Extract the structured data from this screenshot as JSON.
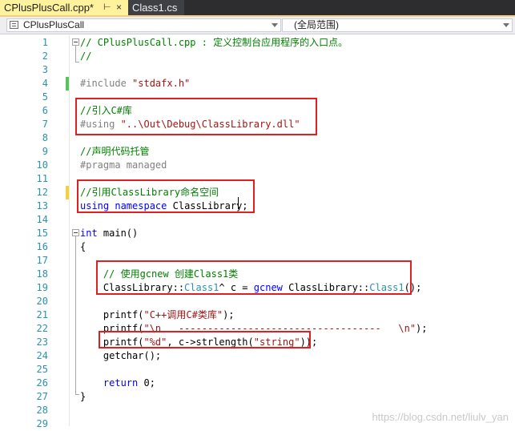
{
  "tabs": {
    "active": {
      "label": "CPlusPlusCall.cpp*",
      "pin": "⊢",
      "close": "×"
    },
    "inactive": {
      "label": "Class1.cs"
    }
  },
  "nav": {
    "project_scope": "CPlusPlusCall",
    "member_scope": "(全局范围)"
  },
  "lines": [
    {
      "n": "1",
      "parts": [
        {
          "t": "// CPlusPlusCall.cpp : 定义控制台应用程序的入口点。",
          "c": "cm"
        }
      ]
    },
    {
      "n": "2",
      "parts": [
        {
          "t": "//",
          "c": "cm"
        }
      ]
    },
    {
      "n": "3",
      "parts": []
    },
    {
      "n": "4",
      "parts": [
        {
          "t": "#include ",
          "c": "pp"
        },
        {
          "t": "\"stdafx.h\"",
          "c": "st"
        }
      ]
    },
    {
      "n": "5",
      "parts": []
    },
    {
      "n": "6",
      "parts": [
        {
          "t": "//引入C#库",
          "c": "cm"
        }
      ]
    },
    {
      "n": "7",
      "parts": [
        {
          "t": "#using ",
          "c": "pp"
        },
        {
          "t": "\"..\\Out\\Debug\\ClassLibrary.dll\"",
          "c": "st"
        }
      ]
    },
    {
      "n": "8",
      "parts": []
    },
    {
      "n": "9",
      "parts": [
        {
          "t": "//声明代码托管",
          "c": "cm"
        }
      ]
    },
    {
      "n": "10",
      "parts": [
        {
          "t": "#pragma managed",
          "c": "pp"
        }
      ]
    },
    {
      "n": "11",
      "parts": []
    },
    {
      "n": "12",
      "parts": [
        {
          "t": "//引用ClassLibrary命名空间",
          "c": "cm"
        }
      ]
    },
    {
      "n": "13",
      "parts": [
        {
          "t": "using",
          "c": "kw"
        },
        {
          "t": " ",
          "c": ""
        },
        {
          "t": "namespace",
          "c": "kw"
        },
        {
          "t": " ClassLibrary;",
          "c": ""
        }
      ]
    },
    {
      "n": "14",
      "parts": []
    },
    {
      "n": "15",
      "parts": [
        {
          "t": "int",
          "c": "kw"
        },
        {
          "t": " main()",
          "c": ""
        }
      ]
    },
    {
      "n": "16",
      "parts": [
        {
          "t": "{",
          "c": ""
        }
      ]
    },
    {
      "n": "17",
      "parts": []
    },
    {
      "n": "18",
      "parts": [
        {
          "t": "    // 使用gcnew 创建Class1类",
          "c": "cm"
        }
      ]
    },
    {
      "n": "19",
      "parts": [
        {
          "t": "    ClassLibrary::",
          "c": ""
        },
        {
          "t": "Class1",
          "c": "ty"
        },
        {
          "t": "^ c = ",
          "c": ""
        },
        {
          "t": "gcnew",
          "c": "kw"
        },
        {
          "t": " ClassLibrary::",
          "c": ""
        },
        {
          "t": "Class1",
          "c": "ty"
        },
        {
          "t": "();",
          "c": ""
        }
      ]
    },
    {
      "n": "20",
      "parts": []
    },
    {
      "n": "21",
      "parts": [
        {
          "t": "    printf(",
          "c": ""
        },
        {
          "t": "\"C++调用C#类库\"",
          "c": "st"
        },
        {
          "t": ");",
          "c": ""
        }
      ]
    },
    {
      "n": "22",
      "parts": [
        {
          "t": "    printf(",
          "c": ""
        },
        {
          "t": "\"\\n   -----------------------------------   \\n\"",
          "c": "st"
        },
        {
          "t": ");",
          "c": ""
        }
      ]
    },
    {
      "n": "23",
      "parts": [
        {
          "t": "    printf(",
          "c": ""
        },
        {
          "t": "\"%d\"",
          "c": "st"
        },
        {
          "t": ", c->strlength(",
          "c": ""
        },
        {
          "t": "\"string\"",
          "c": "st"
        },
        {
          "t": "));",
          "c": ""
        }
      ]
    },
    {
      "n": "24",
      "parts": [
        {
          "t": "    getchar();",
          "c": ""
        }
      ]
    },
    {
      "n": "25",
      "parts": []
    },
    {
      "n": "26",
      "parts": [
        {
          "t": "    ",
          "c": ""
        },
        {
          "t": "return",
          "c": "kw"
        },
        {
          "t": " 0;",
          "c": ""
        }
      ]
    },
    {
      "n": "27",
      "parts": [
        {
          "t": "}",
          "c": ""
        }
      ]
    },
    {
      "n": "28",
      "parts": []
    },
    {
      "n": "29",
      "parts": []
    }
  ],
  "change_markers": [
    {
      "line": "4",
      "color": "#57c45b"
    },
    {
      "line": "12",
      "color": "#f0d23c"
    }
  ],
  "watermark": "https://blog.csdn.net/liulv_yan"
}
